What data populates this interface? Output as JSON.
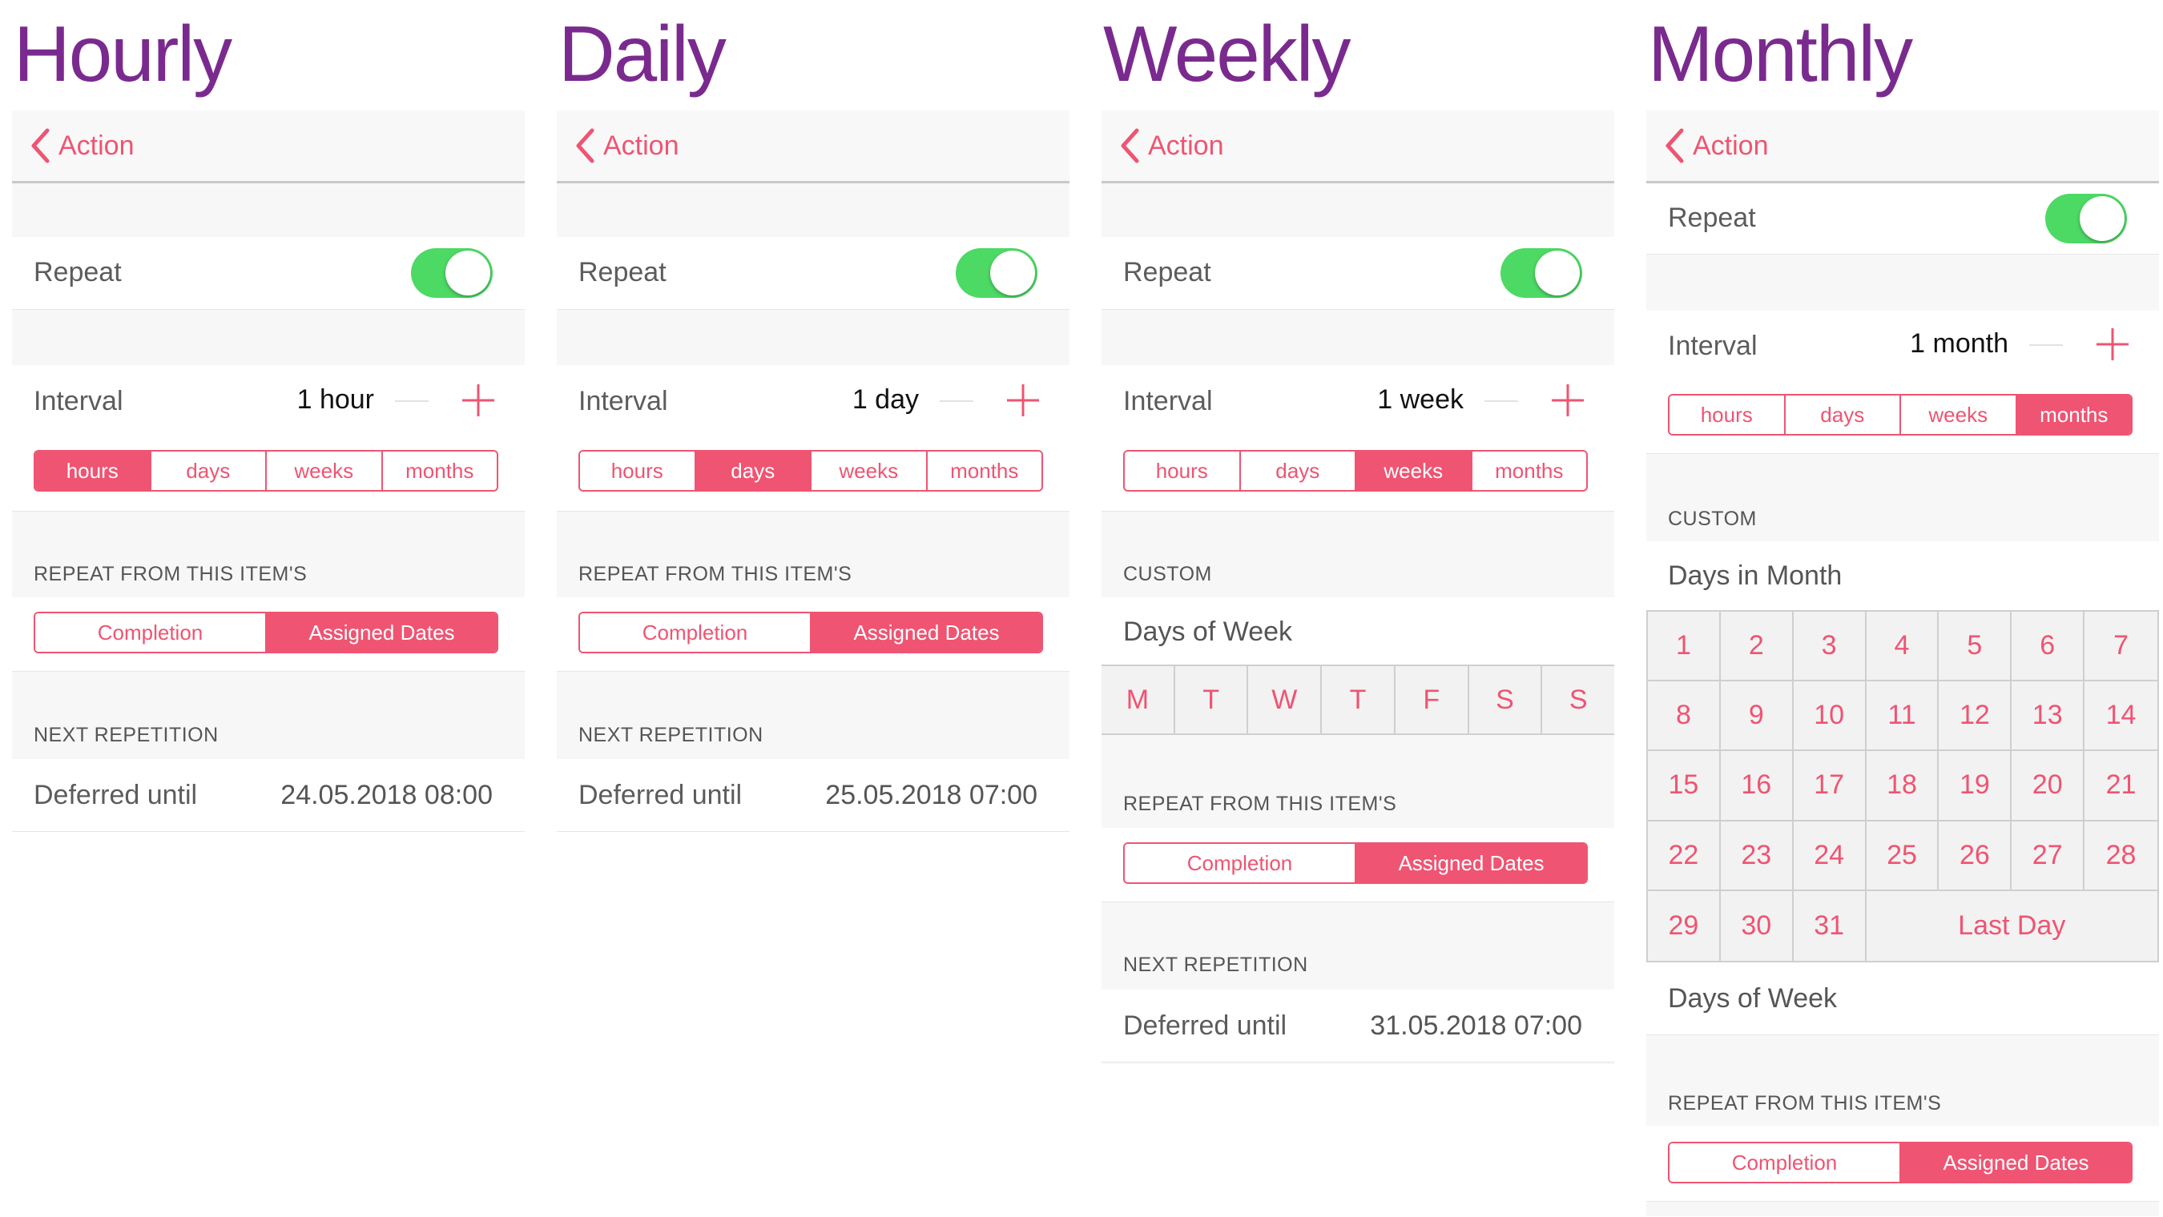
{
  "colors": {
    "accent": "#ef5472",
    "title": "#7a2a8e",
    "toggle_on": "#4cd964",
    "group_bg": "#f7f7f7"
  },
  "icons": {
    "back": "chevron-left-icon",
    "plus": "plus-icon"
  },
  "hourly": {
    "title": "Hourly",
    "back": "Action",
    "repeat_label": "Repeat",
    "interval_label": "Interval",
    "interval_value": "1 hour",
    "units": [
      "hours",
      "days",
      "weeks",
      "months"
    ],
    "unit_selected": "hours",
    "repeat_from_header": "REPEAT FROM THIS ITEM'S",
    "repeat_from": [
      "Completion",
      "Assigned Dates"
    ],
    "repeat_from_selected": "Assigned Dates",
    "next_header": "NEXT REPETITION",
    "deferred_label": "Deferred until",
    "deferred_value": "24.05.2018  08:00"
  },
  "daily": {
    "title": "Daily",
    "back": "Action",
    "repeat_label": "Repeat",
    "interval_label": "Interval",
    "interval_value": "1 day",
    "units": [
      "hours",
      "days",
      "weeks",
      "months"
    ],
    "unit_selected": "days",
    "repeat_from_header": "REPEAT FROM THIS ITEM'S",
    "repeat_from": [
      "Completion",
      "Assigned Dates"
    ],
    "repeat_from_selected": "Assigned Dates",
    "next_header": "NEXT REPETITION",
    "deferred_label": "Deferred until",
    "deferred_value": "25.05.2018  07:00"
  },
  "weekly": {
    "title": "Weekly",
    "back": "Action",
    "repeat_label": "Repeat",
    "interval_label": "Interval",
    "interval_value": "1 week",
    "units": [
      "hours",
      "days",
      "weeks",
      "months"
    ],
    "unit_selected": "weeks",
    "custom_header": "CUSTOM",
    "days_of_week_label": "Days of Week",
    "days": [
      "M",
      "T",
      "W",
      "T",
      "F",
      "S",
      "S"
    ],
    "repeat_from_header": "REPEAT FROM THIS ITEM'S",
    "repeat_from": [
      "Completion",
      "Assigned Dates"
    ],
    "repeat_from_selected": "Assigned Dates",
    "next_header": "NEXT REPETITION",
    "deferred_label": "Deferred until",
    "deferred_value": "31.05.2018  07:00"
  },
  "monthly": {
    "title": "Monthly",
    "back": "Action",
    "repeat_label": "Repeat",
    "interval_label": "Interval",
    "interval_value": "1 month",
    "units": [
      "hours",
      "days",
      "weeks",
      "months"
    ],
    "unit_selected": "months",
    "custom_header": "CUSTOM",
    "days_in_month_label": "Days in Month",
    "month_days": [
      "1",
      "2",
      "3",
      "4",
      "5",
      "6",
      "7",
      "8",
      "9",
      "10",
      "11",
      "12",
      "13",
      "14",
      "15",
      "16",
      "17",
      "18",
      "19",
      "20",
      "21",
      "22",
      "23",
      "24",
      "25",
      "26",
      "27",
      "28",
      "29",
      "30",
      "31"
    ],
    "last_day_label": "Last Day",
    "days_of_week_label": "Days of Week",
    "repeat_from_header": "REPEAT FROM THIS ITEM'S",
    "repeat_from": [
      "Completion",
      "Assigned Dates"
    ],
    "repeat_from_selected": "Assigned Dates"
  }
}
